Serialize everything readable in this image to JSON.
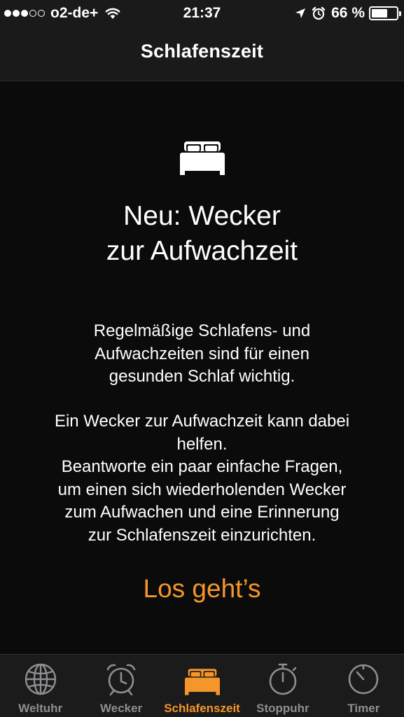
{
  "status_bar": {
    "signal_filled": 3,
    "signal_total": 5,
    "carrier": "o2-de+",
    "time": "21:37",
    "battery_percent": "66 %",
    "battery_level": 0.66,
    "icons": [
      "wifi-icon",
      "location-arrow-icon",
      "alarm-clock-icon",
      "battery-icon"
    ]
  },
  "nav": {
    "title": "Schlafenszeit"
  },
  "content": {
    "icon": "bed-icon",
    "headline_line1": "Neu: Wecker",
    "headline_line2": "zur Aufwachzeit",
    "paragraph1": [
      "Regelmäßige Schlafens- und",
      "Aufwachzeiten sind für einen",
      "gesunden Schlaf wichtig."
    ],
    "paragraph2": [
      "Ein Wecker zur Aufwachzeit kann dabei",
      "helfen."
    ],
    "paragraph3": [
      "Beantworte ein paar einfache Fragen,",
      "um einen sich wiederholenden Wecker",
      "zum Aufwachen und eine Erinnerung",
      "zur Schlafenszeit einzurichten."
    ],
    "cta_label": "Los geht’s"
  },
  "tab_bar": {
    "tabs": [
      {
        "label": "Weltuhr",
        "icon": "globe-icon",
        "active": false
      },
      {
        "label": "Wecker",
        "icon": "alarm-clock-icon",
        "active": false
      },
      {
        "label": "Schlafenszeit",
        "icon": "bed-icon",
        "active": true
      },
      {
        "label": "Stoppuhr",
        "icon": "stopwatch-icon",
        "active": false
      },
      {
        "label": "Timer",
        "icon": "timer-icon",
        "active": false
      }
    ]
  },
  "colors": {
    "accent": "#f5962a",
    "inactive_tab": "#8e8e93",
    "background": "#0b0b0b",
    "bar_background": "#1a1a1a"
  }
}
